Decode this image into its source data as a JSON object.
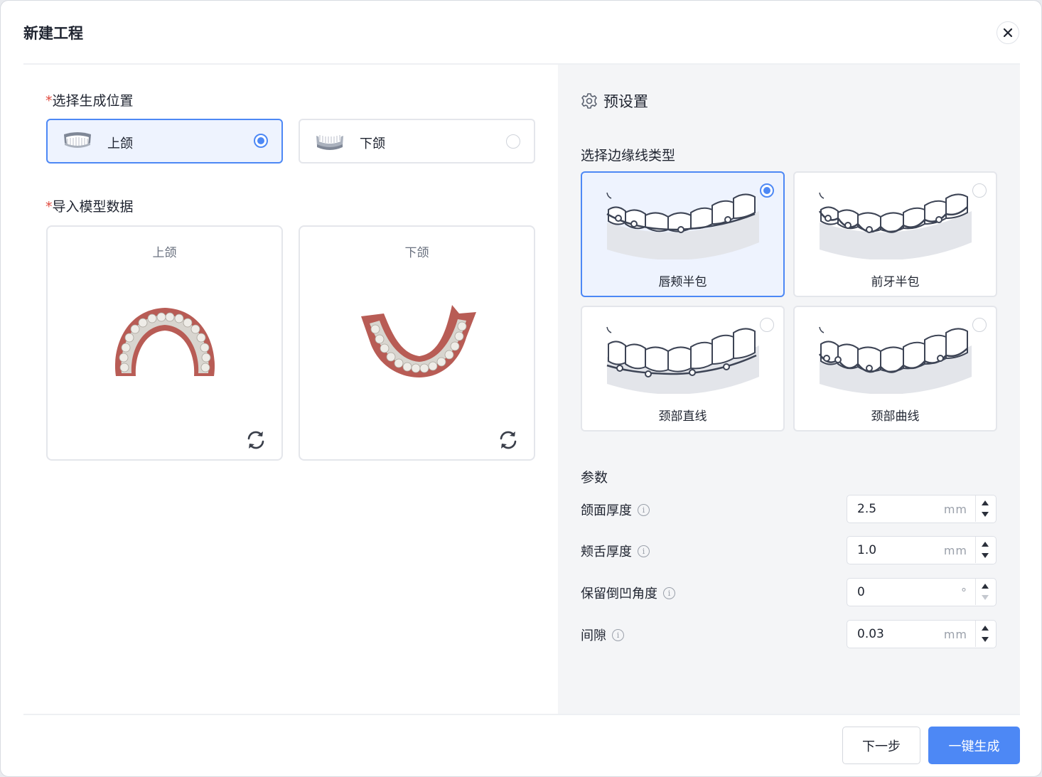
{
  "dialog": {
    "title": "新建工程"
  },
  "left": {
    "position_label": "选择生成位置",
    "required_mark": "*",
    "jaw_options": [
      {
        "label": "上颌",
        "selected": true
      },
      {
        "label": "下颌",
        "selected": false
      }
    ],
    "import_label": "导入模型数据",
    "models": [
      {
        "caption": "上颌"
      },
      {
        "caption": "下颌"
      }
    ]
  },
  "right": {
    "preset_title": "预设置",
    "edge_type_label": "选择边缘线类型",
    "edge_types": [
      {
        "label": "唇颊半包",
        "selected": true
      },
      {
        "label": "前牙半包",
        "selected": false
      },
      {
        "label": "颈部直线",
        "selected": false
      },
      {
        "label": "颈部曲线",
        "selected": false
      }
    ],
    "params_label": "参数",
    "params": [
      {
        "label": "颌面厚度",
        "value": "2.5",
        "unit": "mm"
      },
      {
        "label": "颊舌厚度",
        "value": "1.0",
        "unit": "mm"
      },
      {
        "label": "保留倒凹角度",
        "value": "0",
        "unit": "°"
      },
      {
        "label": "间隙",
        "value": "0.03",
        "unit": "mm"
      }
    ]
  },
  "footer": {
    "next_label": "下一步",
    "generate_label": "一键生成"
  },
  "colors": {
    "accent": "#4d88f5",
    "required": "#e04a3f",
    "panel_bg": "#f4f5f7"
  },
  "icons": [
    "close-icon",
    "gear-icon",
    "info-icon",
    "refresh-icon",
    "up-arrow-icon",
    "down-arrow-icon"
  ]
}
